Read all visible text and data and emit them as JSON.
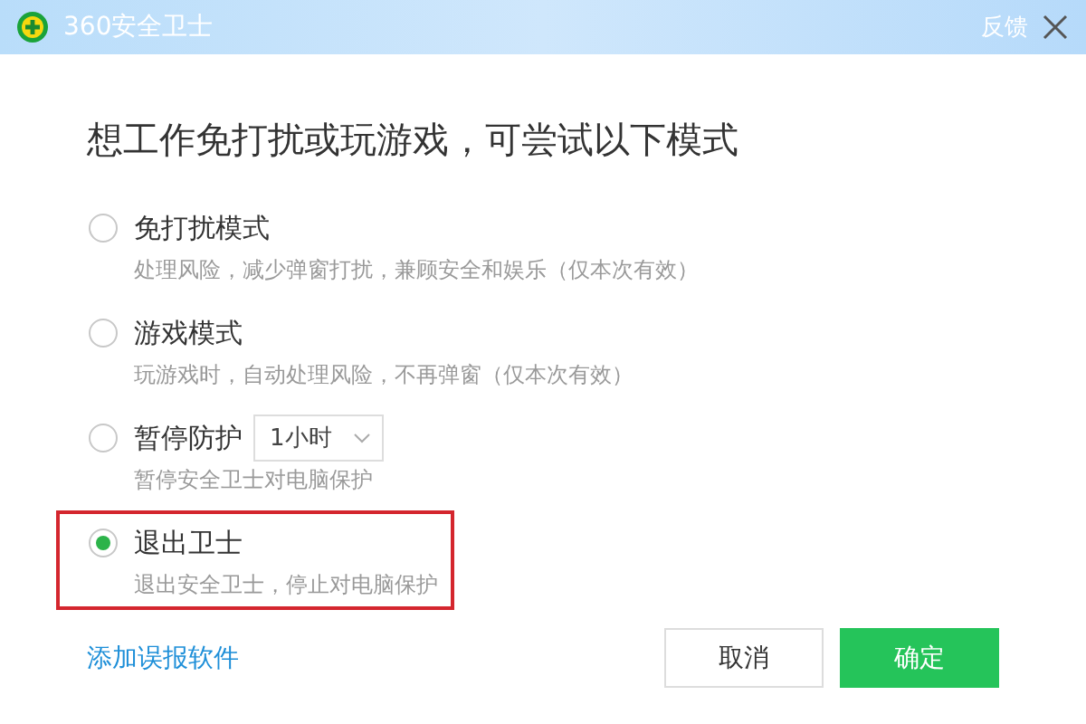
{
  "window": {
    "title": "360安全卫士",
    "feedback": "反馈"
  },
  "heading": "想工作免打扰或玩游戏，可尝试以下模式",
  "options": [
    {
      "kind": "plain",
      "label": "免打扰模式",
      "description": "处理风险，减少弹窗打扰，兼顾安全和娱乐（仅本次有效）",
      "selected": false,
      "highlighted": false
    },
    {
      "kind": "plain",
      "label": "游戏模式",
      "description": "玩游戏时，自动处理风险，不再弹窗（仅本次有效）",
      "selected": false,
      "highlighted": false
    },
    {
      "kind": "duration",
      "label": "暂停防护",
      "dropdown": "1小时",
      "description": "暂停安全卫士对电脑保护",
      "selected": false,
      "highlighted": false
    },
    {
      "kind": "plain",
      "label": "退出卫士",
      "description": "退出安全卫士，停止对电脑保护",
      "selected": true,
      "highlighted": true
    }
  ],
  "link": "添加误报软件",
  "buttons": [
    {
      "kind": "secondary",
      "label": "取消"
    },
    {
      "kind": "primary",
      "label": "确定"
    }
  ]
}
